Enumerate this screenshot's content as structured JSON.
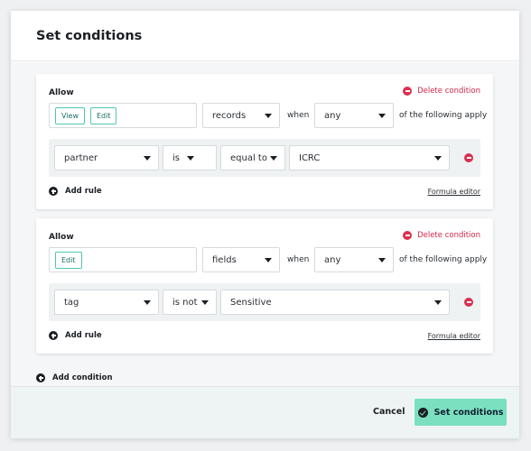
{
  "dialog": {
    "title": "Set conditions",
    "add_condition_label": "Add condition",
    "cancel_label": "Cancel",
    "submit_label": "Set conditions"
  },
  "conditions": [
    {
      "allow_label": "Allow",
      "delete_label": "Delete condition",
      "permissions": [
        "View",
        "Edit"
      ],
      "target": "records",
      "when_label": "when",
      "quantifier": "any",
      "suffix": "of the following apply",
      "rule": {
        "field": "partner",
        "operator": "is",
        "comparison": "equal to",
        "value": "ICRC"
      },
      "add_rule_label": "Add rule",
      "formula_label": "Formula editor"
    },
    {
      "allow_label": "Allow",
      "delete_label": "Delete condition",
      "permissions": [
        "Edit"
      ],
      "target": "fields",
      "when_label": "when",
      "quantifier": "any",
      "suffix": "of the following apply",
      "rule": {
        "field": "tag",
        "operator": "is not",
        "value": "Sensitive"
      },
      "add_rule_label": "Add rule",
      "formula_label": "Formula editor"
    }
  ],
  "colors": {
    "accent": "#7be0bf",
    "danger": "#d9304f",
    "tag_border": "#4fc6b2"
  }
}
